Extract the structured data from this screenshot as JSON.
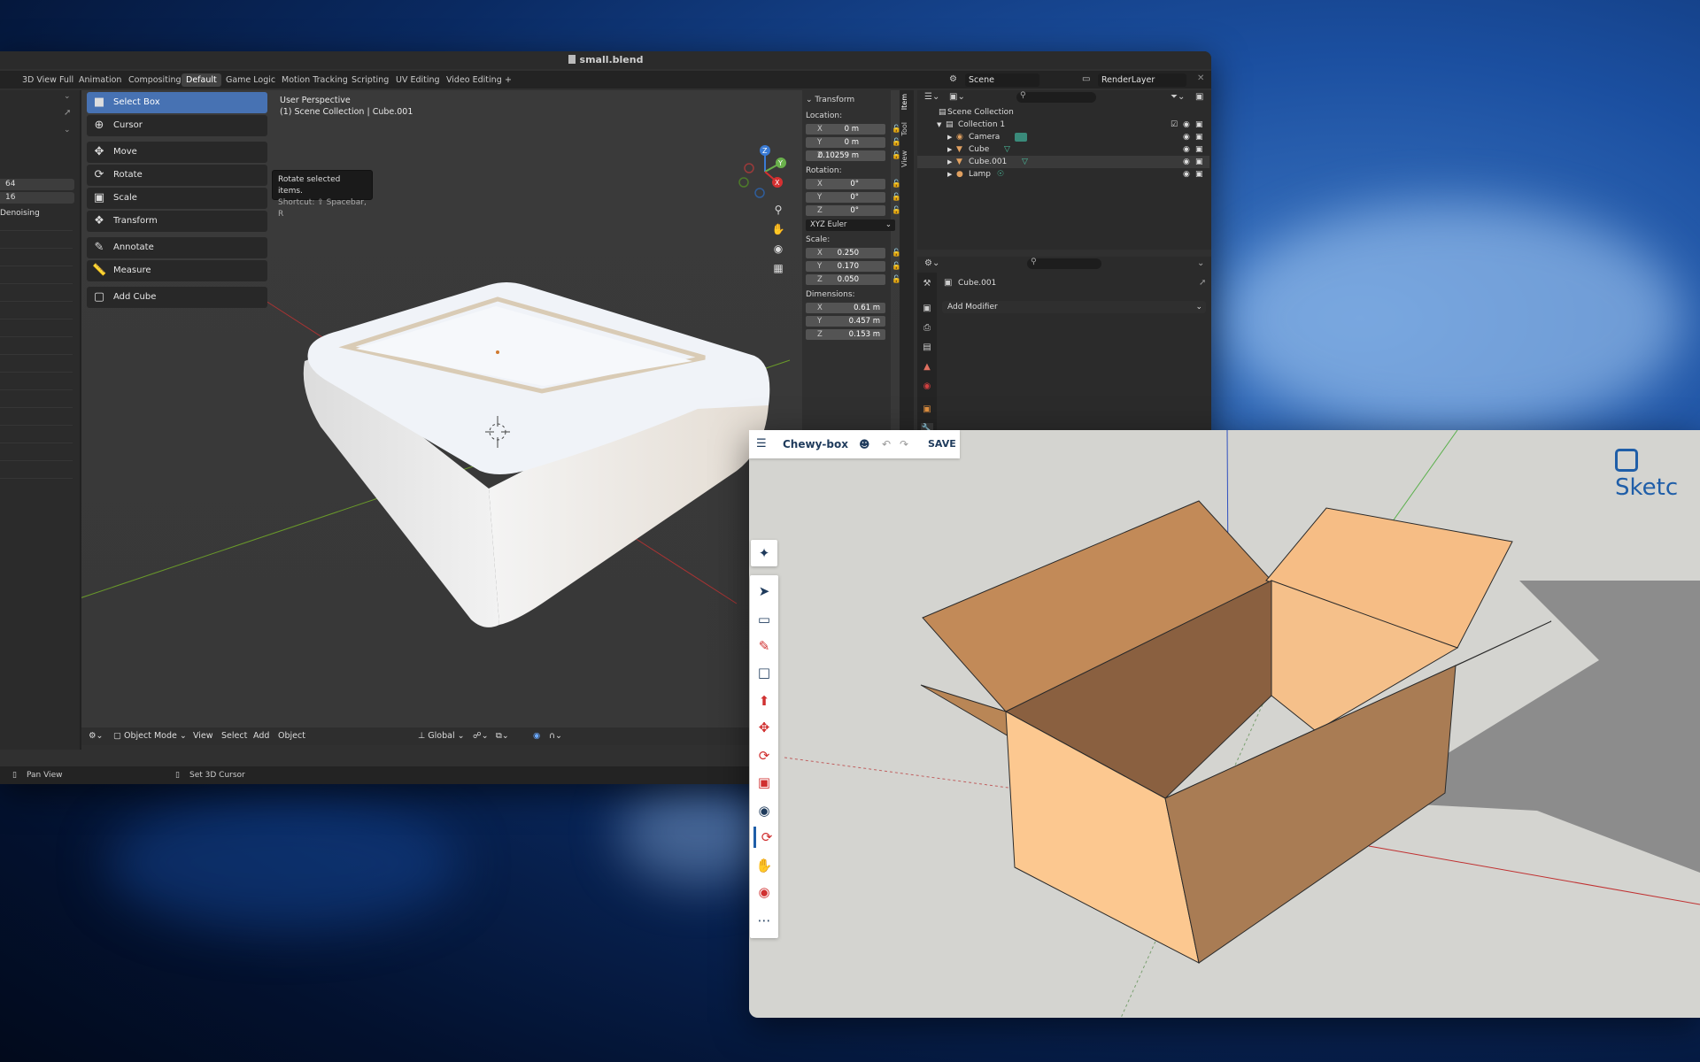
{
  "blender": {
    "title": "small.blend",
    "workspaces": [
      "3D View Full",
      "Animation",
      "Compositing",
      "Default",
      "Game Logic",
      "Motion Tracking",
      "Scripting",
      "UV Editing",
      "Video Editing",
      "+"
    ],
    "scene": "Scene",
    "render_layer": "RenderLayer",
    "left_panel": {
      "value1": "64",
      "value2": "16",
      "label": "Denoising"
    },
    "tools": [
      {
        "label": "Select Box"
      },
      {
        "label": "Cursor"
      },
      {
        "label": "Move"
      },
      {
        "label": "Rotate"
      },
      {
        "label": "Scale"
      },
      {
        "label": "Transform"
      },
      {
        "label": "Annotate"
      },
      {
        "label": "Measure"
      },
      {
        "label": "Add Cube"
      }
    ],
    "tooltip": {
      "title": "Rotate selected items.",
      "shortcut": "Shortcut: ⇧ Spacebar, R"
    },
    "viewport": {
      "perspective": "User Perspective",
      "collection": "(1) Scene Collection | Cube.001"
    },
    "footer": {
      "mode": "Object Mode",
      "menus": [
        "View",
        "Select",
        "Add",
        "Object"
      ],
      "orientation": "Global"
    },
    "npanel": {
      "header": "Transform",
      "location_label": "Location:",
      "location": [
        "0 m",
        "0 m",
        "0.10259 m"
      ],
      "rotation_label": "Rotation:",
      "rotation": [
        "0°",
        "0°",
        "0°"
      ],
      "rotation_mode": "XYZ Euler",
      "scale_label": "Scale:",
      "scale": [
        "0.250",
        "0.170",
        "0.050"
      ],
      "dimensions_label": "Dimensions:",
      "dimensions": [
        "0.61 m",
        "0.457 m",
        "0.153 m"
      ],
      "axes": [
        "X",
        "Y",
        "Z"
      ],
      "tabs": [
        "Item",
        "Tool",
        "View"
      ]
    },
    "outliner": {
      "root": "Scene Collection",
      "collection": "Collection 1",
      "items": [
        "Camera",
        "Cube",
        "Cube.001",
        "Lamp"
      ]
    },
    "properties": {
      "object": "Cube.001",
      "add_modifier": "Add Modifier"
    },
    "status": {
      "left": "Pan View",
      "right": "Set 3D Cursor"
    }
  },
  "sketchup": {
    "title": "Chewy-box",
    "save": "SAVE",
    "logo": "Sketc",
    "more": "⋯",
    "colors": {
      "box_light": "#fcc890",
      "box_dark": "#8a6040",
      "accent": "#1f3b5c"
    }
  }
}
